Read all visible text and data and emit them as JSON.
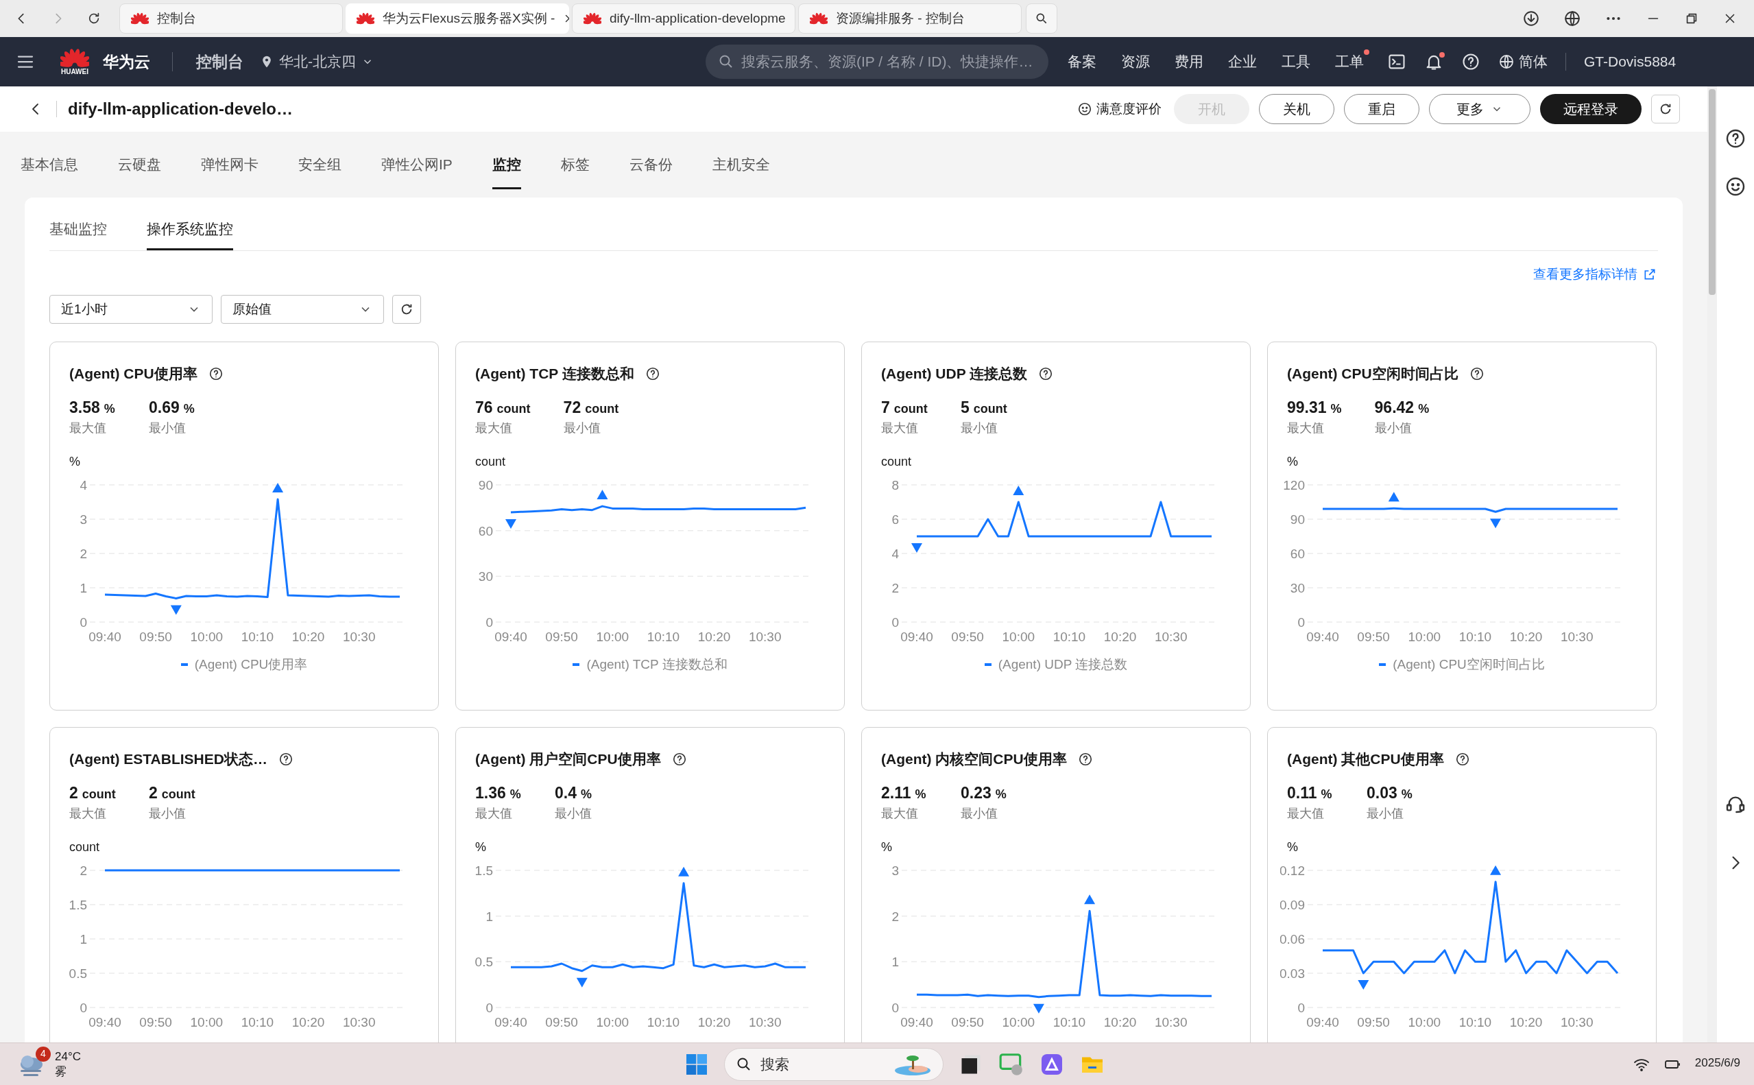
{
  "browser": {
    "tabs": [
      {
        "title": "控制台",
        "selected": false
      },
      {
        "title": "华为云Flexus云服务器X实例 -",
        "selected": true
      },
      {
        "title": "dify-llm-application-developme",
        "selected": false
      },
      {
        "title": "资源编排服务 - 控制台",
        "selected": false
      }
    ]
  },
  "topnav": {
    "logo_text": "HUAWEI",
    "brand": "华为云",
    "console": "控制台",
    "region": "华北-北京四",
    "search_placeholder": "搜索云服务、资源(IP / 名称 / ID)、快捷操作…",
    "links": [
      {
        "label": "备案",
        "dot": false
      },
      {
        "label": "资源",
        "dot": false
      },
      {
        "label": "费用",
        "dot": false
      },
      {
        "label": "企业",
        "dot": false
      },
      {
        "label": "工具",
        "dot": false
      },
      {
        "label": "工单",
        "dot": true
      }
    ],
    "notification_dot": true,
    "language": "简体",
    "user": "GT-Dovis5884"
  },
  "header": {
    "title": "dify-llm-application-develo…",
    "feedback": "满意度评价",
    "buttons": [
      {
        "label": "开机",
        "kind": "default",
        "disabled": true
      },
      {
        "label": "关机",
        "kind": "default",
        "disabled": false
      },
      {
        "label": "重启",
        "kind": "default",
        "disabled": false
      },
      {
        "label": "更多",
        "kind": "dropdown",
        "disabled": false
      },
      {
        "label": "远程登录",
        "kind": "primary",
        "disabled": false
      }
    ]
  },
  "tabs": [
    {
      "label": "基本信息",
      "selected": false
    },
    {
      "label": "云硬盘",
      "selected": false
    },
    {
      "label": "弹性网卡",
      "selected": false
    },
    {
      "label": "安全组",
      "selected": false
    },
    {
      "label": "弹性公网IP",
      "selected": false
    },
    {
      "label": "监控",
      "selected": true
    },
    {
      "label": "标签",
      "selected": false
    },
    {
      "label": "云备份",
      "selected": false
    },
    {
      "label": "主机安全",
      "selected": false
    }
  ],
  "subtabs": [
    {
      "label": "基础监控",
      "selected": false
    },
    {
      "label": "操作系统监控",
      "selected": true
    }
  ],
  "more_link": "查看更多指标详情",
  "filters": {
    "period": "近1小时",
    "value_type": "原始值"
  },
  "cards": [
    {
      "title": "(Agent) CPU使用率",
      "max": {
        "value": "3.58",
        "unit": "%"
      },
      "min": {
        "value": "0.69",
        "unit": "%"
      },
      "max_label": "最大值",
      "min_label": "最小值",
      "unit_label": "%",
      "chart_data": {
        "type": "line",
        "grid": true,
        "categories": [
          "09:40",
          null,
          null,
          null,
          null,
          "09:50",
          null,
          null,
          null,
          null,
          "10:00",
          null,
          null,
          null,
          null,
          "10:10",
          null,
          null,
          null,
          null,
          "10:20",
          null,
          null,
          null,
          null,
          "10:30",
          null,
          null,
          null,
          null
        ],
        "ylim": [
          0,
          4
        ],
        "yticks": [
          0,
          1,
          2,
          3,
          4
        ],
        "series": [
          {
            "name": "(Agent) CPU使用率",
            "color": "#1476ff",
            "values": [
              0.8,
              0.79,
              0.78,
              0.77,
              0.76,
              0.83,
              0.75,
              0.69,
              0.76,
              0.75,
              0.75,
              0.78,
              0.75,
              0.74,
              0.76,
              0.75,
              0.73,
              3.58,
              0.78,
              0.77,
              0.76,
              0.75,
              0.74,
              0.77,
              0.76,
              0.77,
              0.78,
              0.75,
              0.74,
              0.74
            ]
          }
        ]
      }
    },
    {
      "title": "(Agent) TCP 连接数总和",
      "max": {
        "value": "76",
        "unit": "count"
      },
      "min": {
        "value": "72",
        "unit": "count"
      },
      "max_label": "最大值",
      "min_label": "最小值",
      "unit_label": "count",
      "chart_data": {
        "type": "line",
        "grid": true,
        "categories": [
          "09:40",
          null,
          null,
          null,
          null,
          "09:50",
          null,
          null,
          null,
          null,
          "10:00",
          null,
          null,
          null,
          null,
          "10:10",
          null,
          null,
          null,
          null,
          "10:20",
          null,
          null,
          null,
          null,
          "10:30",
          null,
          null,
          null,
          null
        ],
        "ylim": [
          0,
          90
        ],
        "yticks": [
          0,
          30,
          60,
          90
        ],
        "series": [
          {
            "name": "(Agent) TCP 连接数总和",
            "color": "#1476ff",
            "values": [
              72,
              72.3,
              72.6,
              72.9,
              73.2,
              74,
              73.5,
              74,
              73.5,
              76,
              74.5,
              74.5,
              74.5,
              74,
              74,
              74,
              74,
              74,
              74.5,
              74.5,
              74,
              74,
              74,
              74,
              74,
              74,
              74,
              74,
              74,
              75
            ]
          }
        ]
      }
    },
    {
      "title": "(Agent) UDP 连接总数",
      "max": {
        "value": "7",
        "unit": "count"
      },
      "min": {
        "value": "5",
        "unit": "count"
      },
      "max_label": "最大值",
      "min_label": "最小值",
      "unit_label": "count",
      "chart_data": {
        "type": "line",
        "grid": true,
        "categories": [
          "09:40",
          null,
          null,
          null,
          null,
          "09:50",
          null,
          null,
          null,
          null,
          "10:00",
          null,
          null,
          null,
          null,
          "10:10",
          null,
          null,
          null,
          null,
          "10:20",
          null,
          null,
          null,
          null,
          "10:30",
          null,
          null,
          null,
          null
        ],
        "ylim": [
          0,
          8
        ],
        "yticks": [
          0,
          2,
          4,
          6,
          8
        ],
        "series": [
          {
            "name": "(Agent) UDP 连接总数",
            "color": "#1476ff",
            "values": [
              5,
              5,
              5,
              5,
              5,
              5,
              5,
              6,
              5,
              5,
              7,
              5,
              5,
              5,
              5,
              5,
              5,
              5,
              5,
              5,
              5,
              5,
              5,
              5,
              7,
              5,
              5,
              5,
              5,
              5
            ]
          }
        ]
      }
    },
    {
      "title": "(Agent) CPU空闲时间占比",
      "max": {
        "value": "99.31",
        "unit": "%"
      },
      "min": {
        "value": "96.42",
        "unit": "%"
      },
      "max_label": "最大值",
      "min_label": "最小值",
      "unit_label": "%",
      "chart_data": {
        "type": "line",
        "grid": true,
        "categories": [
          "09:40",
          null,
          null,
          null,
          null,
          "09:50",
          null,
          null,
          null,
          null,
          "10:00",
          null,
          null,
          null,
          null,
          "10:10",
          null,
          null,
          null,
          null,
          "10:20",
          null,
          null,
          null,
          null,
          "10:30",
          null,
          null,
          null,
          null
        ],
        "ylim": [
          0,
          120
        ],
        "yticks": [
          0,
          30,
          60,
          90,
          120
        ],
        "series": [
          {
            "name": "(Agent) CPU空闲时间占比",
            "color": "#1476ff",
            "values": [
              99,
              99,
              99,
              99,
              99,
              99,
              99,
              99.5,
              99,
              99,
              99,
              99,
              99,
              99,
              99,
              99,
              99,
              96.5,
              99,
              99,
              99,
              99,
              99,
              99,
              99,
              99,
              99,
              99,
              99,
              99
            ]
          }
        ]
      }
    },
    {
      "title": "(Agent) ESTABLISHED状态…",
      "max": {
        "value": "2",
        "unit": "count"
      },
      "min": {
        "value": "2",
        "unit": "count"
      },
      "max_label": "最大值",
      "min_label": "最小值",
      "unit_label": "count",
      "chart_data": {
        "type": "line",
        "grid": true,
        "categories": [
          "09:40",
          null,
          null,
          null,
          null,
          "09:50",
          null,
          null,
          null,
          null,
          "10:00",
          null,
          null,
          null,
          null,
          "10:10",
          null,
          null,
          null,
          null,
          "10:20",
          null,
          null,
          null,
          null,
          "10:30",
          null,
          null,
          null,
          null
        ],
        "ylim": [
          0,
          2
        ],
        "yticks": [
          0,
          0.5,
          1,
          1.5,
          2
        ],
        "series": [
          {
            "color": "#1476ff",
            "values": [
              2,
              2,
              2,
              2,
              2,
              2,
              2,
              2,
              2,
              2,
              2,
              2,
              2,
              2,
              2,
              2,
              2,
              2,
              2,
              2,
              2,
              2,
              2,
              2,
              2,
              2,
              2,
              2,
              2,
              2
            ]
          }
        ]
      }
    },
    {
      "title": "(Agent) 用户空间CPU使用率",
      "max": {
        "value": "1.36",
        "unit": "%"
      },
      "min": {
        "value": "0.4",
        "unit": "%"
      },
      "max_label": "最大值",
      "min_label": "最小值",
      "unit_label": "%",
      "chart_data": {
        "type": "line",
        "grid": true,
        "categories": [
          "09:40",
          null,
          null,
          null,
          null,
          "09:50",
          null,
          null,
          null,
          null,
          "10:00",
          null,
          null,
          null,
          null,
          "10:10",
          null,
          null,
          null,
          null,
          "10:20",
          null,
          null,
          null,
          null,
          "10:30",
          null,
          null,
          null,
          null
        ],
        "ylim": [
          0,
          1.5
        ],
        "yticks": [
          0,
          0.5,
          1,
          1.5
        ],
        "series": [
          {
            "color": "#1476ff",
            "values": [
              0.44,
              0.44,
              0.44,
              0.44,
              0.45,
              0.48,
              0.43,
              0.4,
              0.46,
              0.44,
              0.44,
              0.47,
              0.44,
              0.45,
              0.44,
              0.43,
              0.47,
              1.36,
              0.46,
              0.44,
              0.47,
              0.44,
              0.45,
              0.46,
              0.44,
              0.45,
              0.48,
              0.44,
              0.44,
              0.44
            ]
          }
        ]
      }
    },
    {
      "title": "(Agent) 内核空间CPU使用率",
      "max": {
        "value": "2.11",
        "unit": "%"
      },
      "min": {
        "value": "0.23",
        "unit": "%"
      },
      "max_label": "最大值",
      "min_label": "最小值",
      "unit_label": "%",
      "chart_data": {
        "type": "line",
        "grid": true,
        "categories": [
          "09:40",
          null,
          null,
          null,
          null,
          "09:50",
          null,
          null,
          null,
          null,
          "10:00",
          null,
          null,
          null,
          null,
          "10:10",
          null,
          null,
          null,
          null,
          "10:20",
          null,
          null,
          null,
          null,
          "10:30",
          null,
          null,
          null,
          null
        ],
        "ylim": [
          0,
          3
        ],
        "yticks": [
          0,
          1,
          2,
          3
        ],
        "series": [
          {
            "color": "#1476ff",
            "values": [
              0.28,
              0.28,
              0.27,
              0.27,
              0.27,
              0.28,
              0.25,
              0.27,
              0.26,
              0.25,
              0.26,
              0.26,
              0.23,
              0.25,
              0.26,
              0.27,
              0.27,
              2.11,
              0.27,
              0.26,
              0.26,
              0.27,
              0.26,
              0.25,
              0.27,
              0.26,
              0.26,
              0.26,
              0.25,
              0.25
            ]
          }
        ]
      }
    },
    {
      "title": "(Agent) 其他CPU使用率",
      "max": {
        "value": "0.11",
        "unit": "%"
      },
      "min": {
        "value": "0.03",
        "unit": "%"
      },
      "max_label": "最大值",
      "min_label": "最小值",
      "unit_label": "%",
      "chart_data": {
        "type": "line",
        "grid": true,
        "categories": [
          "09:40",
          null,
          null,
          null,
          null,
          "09:50",
          null,
          null,
          null,
          null,
          "10:00",
          null,
          null,
          null,
          null,
          "10:10",
          null,
          null,
          null,
          null,
          "10:20",
          null,
          null,
          null,
          null,
          "10:30",
          null,
          null,
          null,
          null
        ],
        "ylim": [
          0,
          0.12
        ],
        "yticks": [
          0,
          0.03,
          0.06,
          0.09,
          0.12
        ],
        "series": [
          {
            "color": "#1476ff",
            "values": [
              0.05,
              0.05,
              0.05,
              0.05,
              0.03,
              0.04,
              0.04,
              0.04,
              0.03,
              0.04,
              0.04,
              0.04,
              0.05,
              0.03,
              0.05,
              0.04,
              0.04,
              0.11,
              0.04,
              0.05,
              0.03,
              0.04,
              0.04,
              0.03,
              0.05,
              0.04,
              0.03,
              0.04,
              0.04,
              0.03
            ]
          }
        ]
      }
    }
  ],
  "taskbar": {
    "weather_badge": "4",
    "temperature": "24°C",
    "weather": "雾",
    "search_label": "搜索",
    "date": "2025/6/9"
  }
}
